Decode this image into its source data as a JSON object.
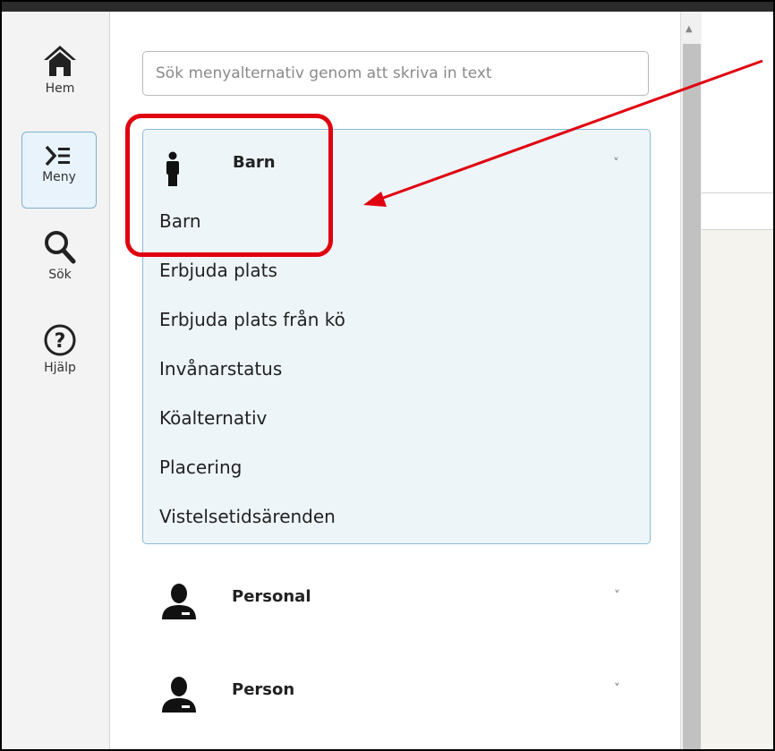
{
  "rail": {
    "items": [
      {
        "label": "Hem",
        "icon": "home-icon"
      },
      {
        "label": "Meny",
        "icon": "menu-icon"
      },
      {
        "label": "Sök",
        "icon": "search-icon"
      },
      {
        "label": "Hjälp",
        "icon": "help-icon"
      }
    ]
  },
  "search": {
    "placeholder": "Sök menyalternativ genom att skriva in text"
  },
  "menu": {
    "groups": [
      {
        "title": "Barn",
        "icon": "child-person-icon",
        "items": [
          "Barn",
          "Erbjuda plats",
          "Erbjuda plats från kö",
          "Invånarstatus",
          "Köalternativ",
          "Placering",
          "Vistelsetidsärenden"
        ]
      },
      {
        "title": "Personal",
        "icon": "staff-person-icon"
      },
      {
        "title": "Person",
        "icon": "person-icon"
      }
    ]
  },
  "chevron": "˅",
  "colors": {
    "accent_border": "#8cb9d6",
    "open_group_bg": "#eef5f9",
    "annotation_red": "#e0000f"
  }
}
